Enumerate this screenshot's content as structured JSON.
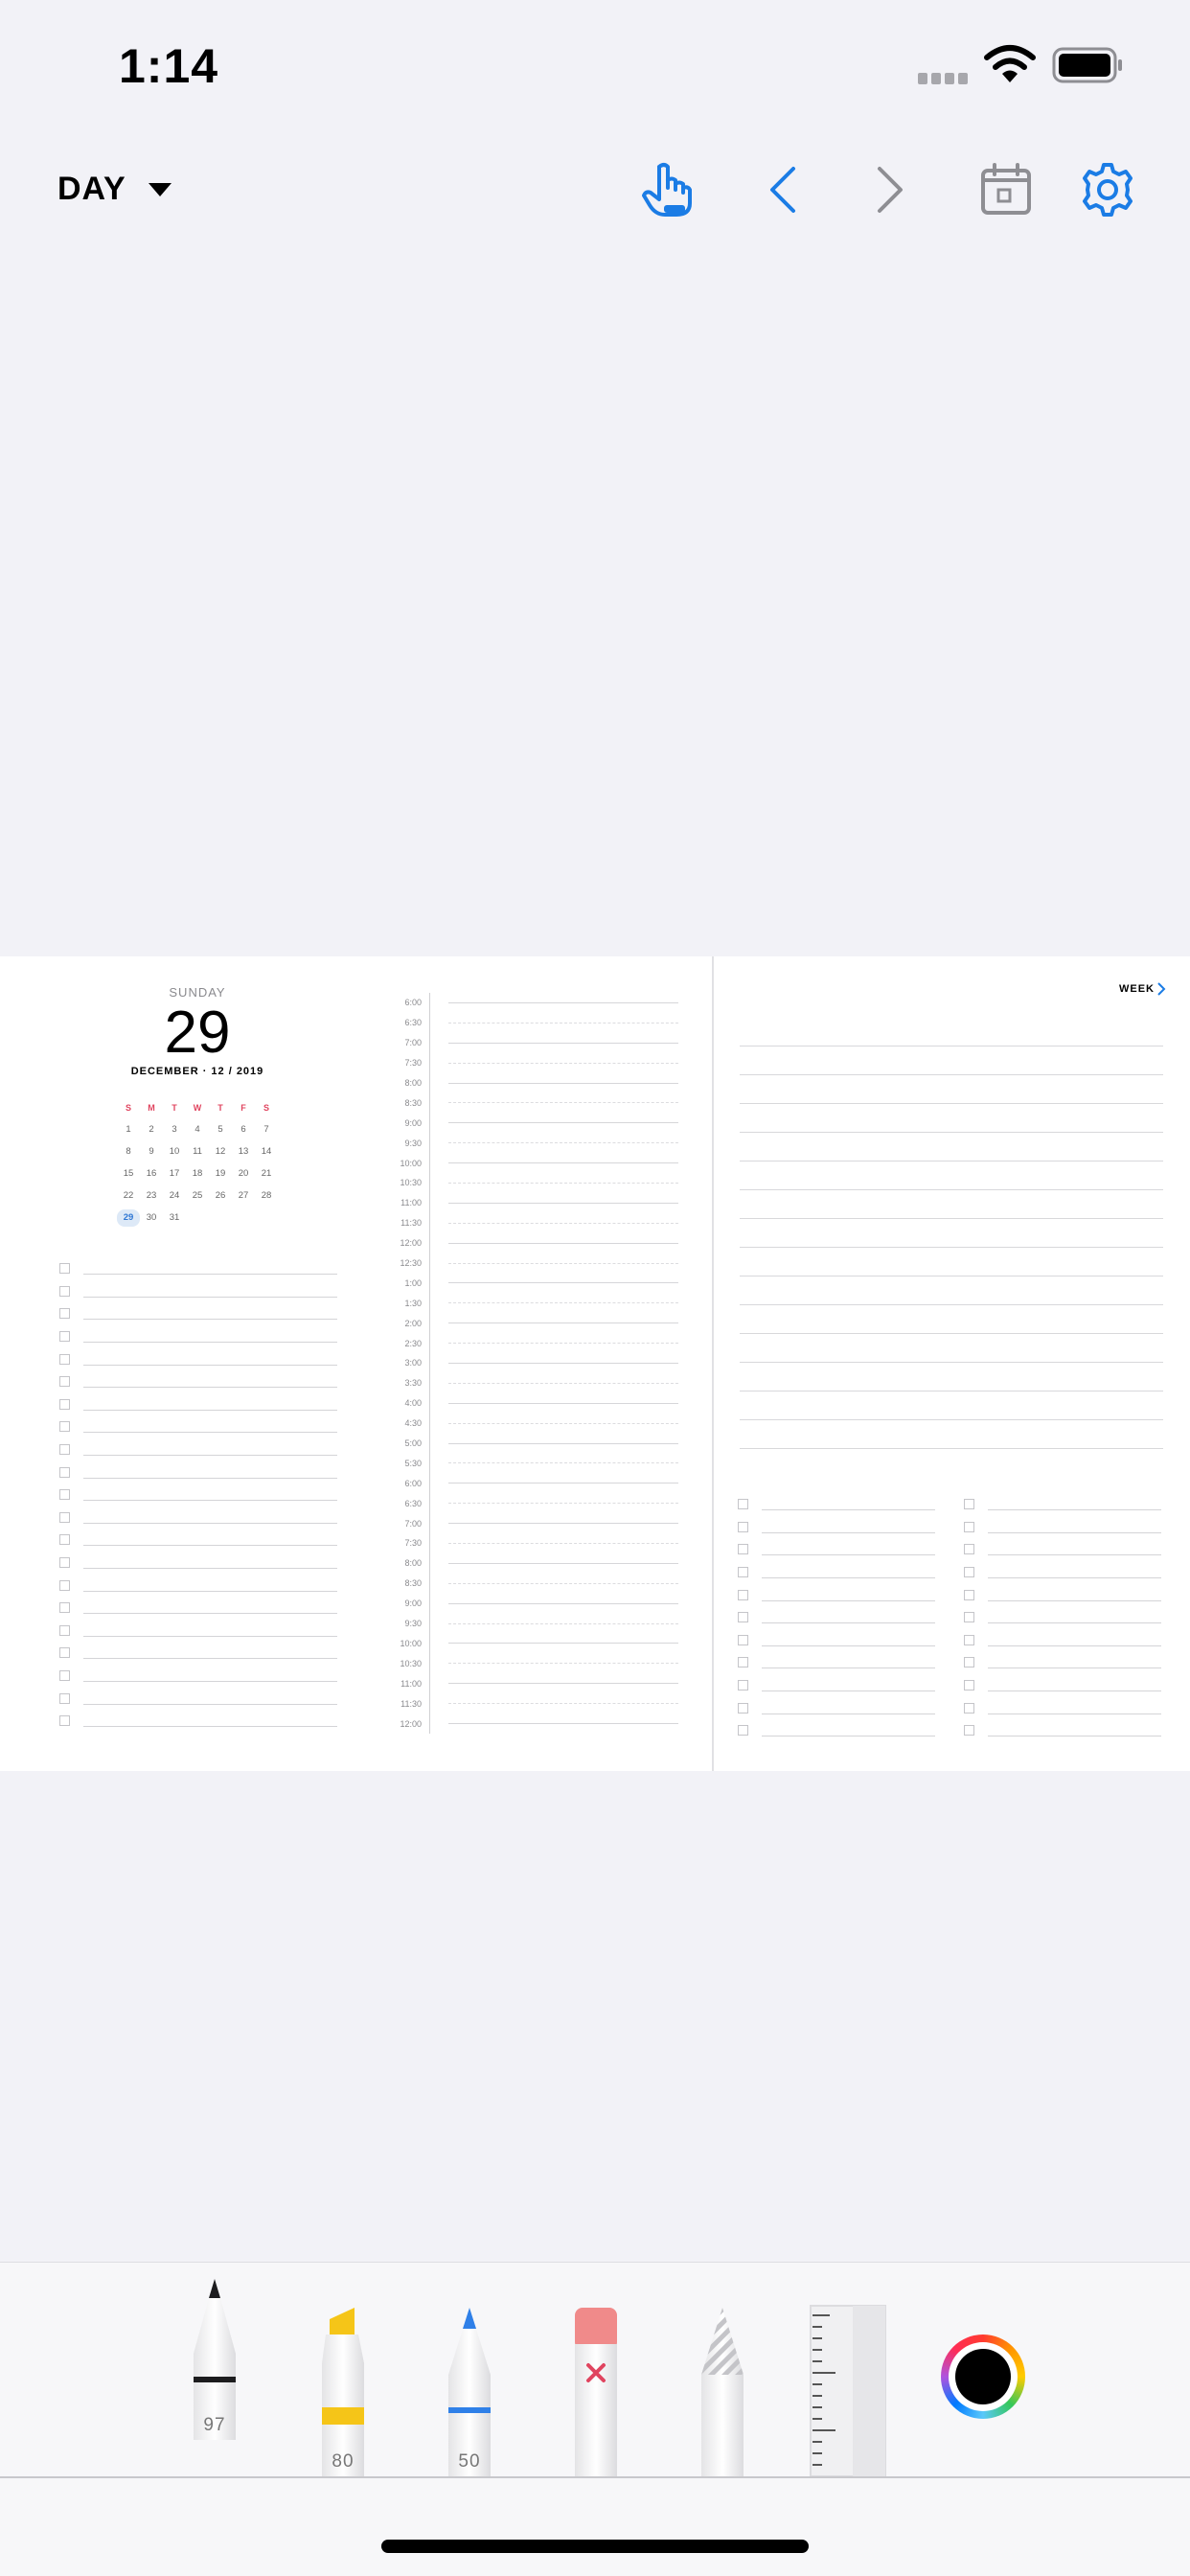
{
  "status_bar": {
    "time": "1:14"
  },
  "toolbar": {
    "view_mode": "DAY",
    "icons": [
      "touch-hand-icon",
      "chevron-left-icon",
      "chevron-right-icon",
      "calendar-icon",
      "gear-icon"
    ],
    "accent": "#1b7ce5"
  },
  "planner": {
    "weekday": "SUNDAY",
    "day": "29",
    "month_line": "DECEMBER · 12 / 2019",
    "calendar": {
      "headers": [
        "S",
        "M",
        "T",
        "W",
        "T",
        "F",
        "S"
      ],
      "weeks": [
        [
          "1",
          "2",
          "3",
          "4",
          "5",
          "6",
          "7"
        ],
        [
          "8",
          "9",
          "10",
          "11",
          "12",
          "13",
          "14"
        ],
        [
          "15",
          "16",
          "17",
          "18",
          "19",
          "20",
          "21"
        ],
        [
          "22",
          "23",
          "24",
          "25",
          "26",
          "27",
          "28"
        ],
        [
          "29",
          "30",
          "31",
          "",
          "",
          "",
          ""
        ]
      ],
      "today": "29"
    },
    "times": [
      "6:00",
      "6:30",
      "7:00",
      "7:30",
      "8:00",
      "8:30",
      "9:00",
      "9:30",
      "10:00",
      "10:30",
      "11:00",
      "11:30",
      "12:00",
      "12:30",
      "1:00",
      "1:30",
      "2:00",
      "2:30",
      "3:00",
      "3:30",
      "4:00",
      "4:30",
      "5:00",
      "5:30",
      "6:00",
      "6:30",
      "7:00",
      "7:30",
      "8:00",
      "8:30",
      "9:00",
      "9:30",
      "10:00",
      "10:30",
      "11:00",
      "11:30",
      "12:00"
    ],
    "week_link": "WEEK",
    "left_todo_count": 21,
    "right_todo_count": 11,
    "note_line_count": 15
  },
  "palette": {
    "tools": [
      {
        "name": "pen",
        "label": "97",
        "color": "#1c1c1e"
      },
      {
        "name": "marker",
        "label": "80",
        "color": "#f5c518"
      },
      {
        "name": "pencil",
        "label": "50",
        "color": "#2f80e8"
      },
      {
        "name": "eraser",
        "label": "",
        "color": "#f08a8a"
      },
      {
        "name": "lasso",
        "label": "",
        "color": "#cfcfd3"
      },
      {
        "name": "ruler",
        "label": "",
        "color": "#f0f0f2"
      }
    ],
    "current_color": "#000000"
  }
}
